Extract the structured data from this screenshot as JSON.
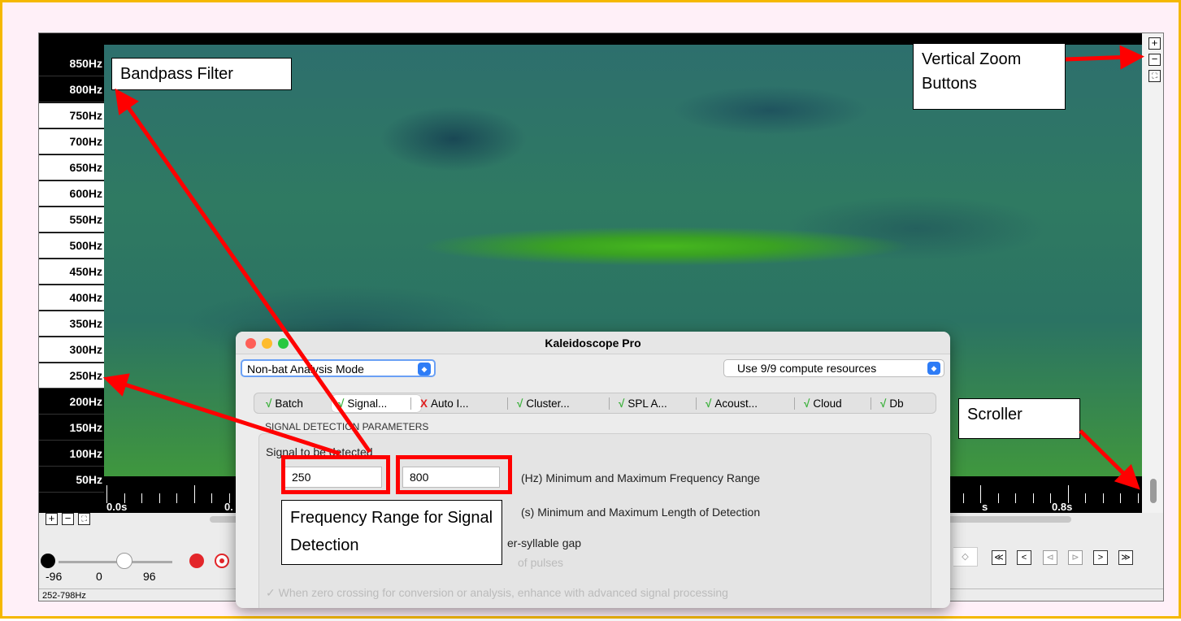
{
  "app": {
    "freq_labels": [
      {
        "label": "850Hz",
        "style": "dark"
      },
      {
        "label": "800Hz",
        "style": "dark"
      },
      {
        "label": "750Hz",
        "style": "light"
      },
      {
        "label": "700Hz",
        "style": "light"
      },
      {
        "label": "650Hz",
        "style": "light"
      },
      {
        "label": "600Hz",
        "style": "light"
      },
      {
        "label": "550Hz",
        "style": "light"
      },
      {
        "label": "500Hz",
        "style": "light"
      },
      {
        "label": "450Hz",
        "style": "light"
      },
      {
        "label": "400Hz",
        "style": "light"
      },
      {
        "label": "350Hz",
        "style": "light"
      },
      {
        "label": "300Hz",
        "style": "light"
      },
      {
        "label": "250Hz",
        "style": "light"
      },
      {
        "label": "200Hz",
        "style": "dark"
      },
      {
        "label": "150Hz",
        "style": "dark"
      },
      {
        "label": "100Hz",
        "style": "dark"
      },
      {
        "label": "50Hz",
        "style": "dark"
      }
    ],
    "time_labels": {
      "t0": "0.0s",
      "t1": "0.",
      "t2": "s",
      "t3": "0.8s"
    },
    "slider": {
      "min_label": "-96",
      "mid_label": "0",
      "max_label": "96"
    },
    "status": "252-798Hz",
    "zoom_in_glyph": "+",
    "zoom_out_glyph": "−",
    "zoom_fit_glyph": "⛶",
    "nav_glyphs": [
      "≪",
      "<",
      "⊲",
      "⊳",
      ">",
      "≫"
    ]
  },
  "dialog": {
    "title": "Kaleidoscope Pro",
    "mode_select": "Non-bat Analysis Mode",
    "resources_select": "Use 9/9 compute resources",
    "tabs": [
      {
        "mark": "√",
        "label": "Batch",
        "status": "ok"
      },
      {
        "mark": "√",
        "label": "Signal...",
        "status": "ok"
      },
      {
        "mark": "X",
        "label": "Auto I...",
        "status": "error"
      },
      {
        "mark": "√",
        "label": "Cluster...",
        "status": "ok"
      },
      {
        "mark": "√",
        "label": "SPL A...",
        "status": "ok"
      },
      {
        "mark": "√",
        "label": "Acoust...",
        "status": "ok"
      },
      {
        "mark": "√",
        "label": "Cloud",
        "status": "ok"
      },
      {
        "mark": "√",
        "label": "Db",
        "status": "ok"
      }
    ],
    "section_label": "SIGNAL DETECTION PARAMETERS",
    "signal_label": "Signal to be detected",
    "min_freq": "250",
    "max_freq": "800",
    "freq_desc": "(Hz) Minimum and Maximum Frequency Range",
    "length_desc": "(s) Minimum and Maximum Length of Detection",
    "gap_desc": "er-syllable gap",
    "pulses_desc": "of pulses",
    "zc_desc": "When zero crossing for conversion or analysis, enhance with advanced signal processing"
  },
  "annotations": {
    "bandpass": "Bandpass Filter",
    "vertical_zoom": "Vertical Zoom Buttons",
    "scroller": "Scroller",
    "freq_range": "Frequency Range for Signal Detection",
    "arrow_color": "#ff0000"
  }
}
